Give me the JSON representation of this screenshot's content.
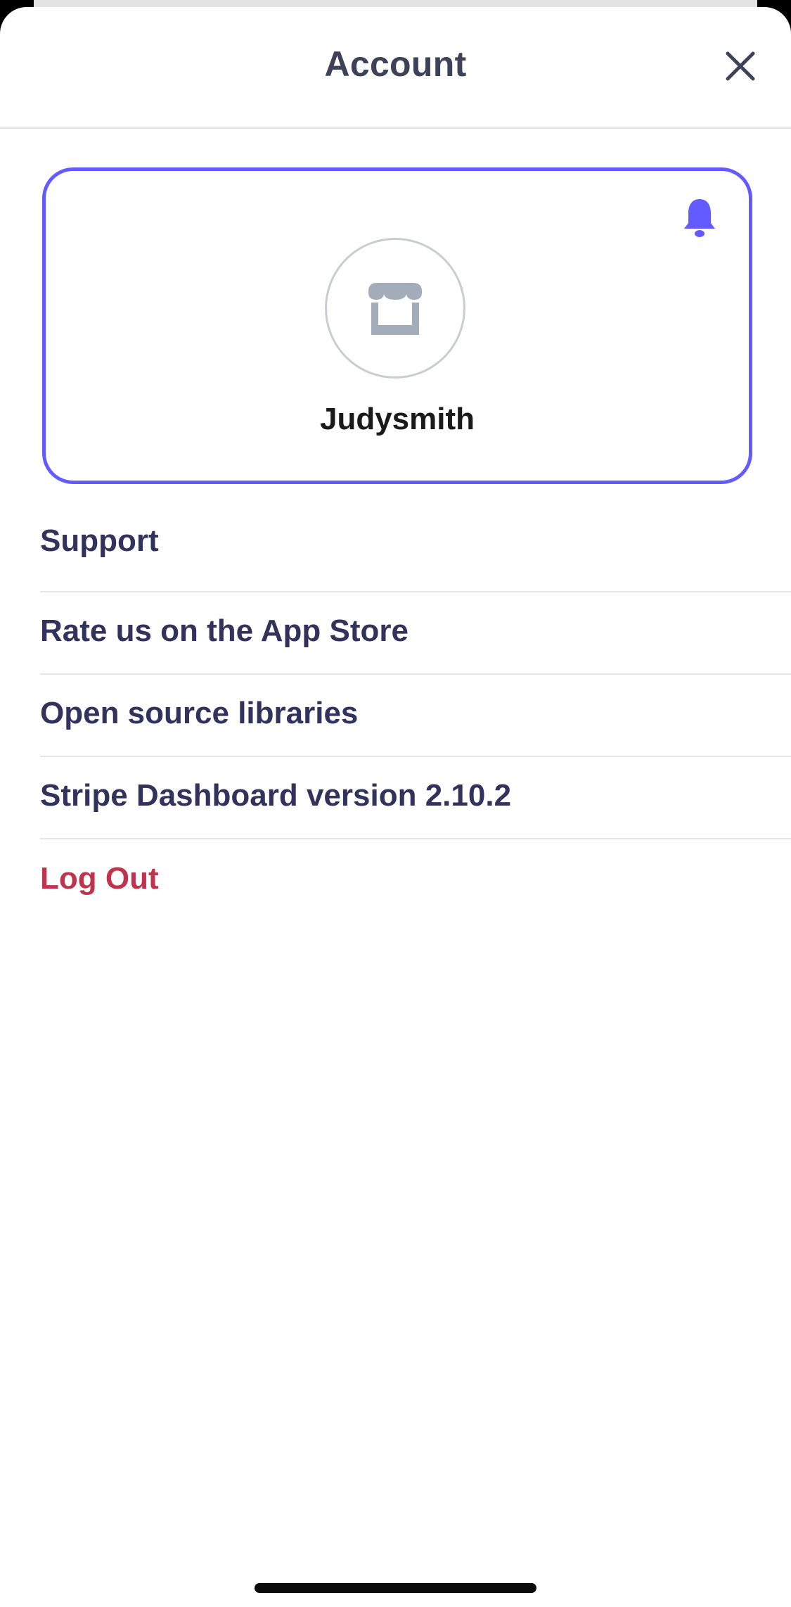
{
  "header": {
    "title": "Account",
    "close_icon": "close-icon"
  },
  "account_card": {
    "name": "Judysmith",
    "avatar_icon": "storefront-icon",
    "notification_icon": "bell-icon",
    "accent_color": "#635bff"
  },
  "menu": {
    "items": [
      {
        "label": "Support"
      },
      {
        "label": "Rate us on the App Store"
      },
      {
        "label": "Open source libraries"
      },
      {
        "label": "Stripe Dashboard version 2.10.2"
      }
    ],
    "logout_label": "Log Out",
    "logout_color": "#c0334d"
  }
}
